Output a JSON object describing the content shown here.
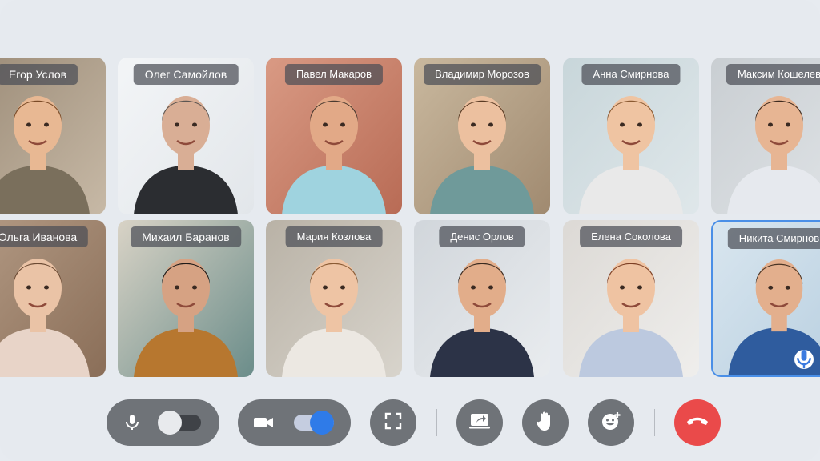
{
  "participants": [
    {
      "name": "Егор Услов",
      "skin": "#e8b893",
      "hair": "#7a4a26",
      "shirt": "#7a6f5c",
      "bg": "#c7b9a6",
      "bg2": "#9c8c78"
    },
    {
      "name": "Олег Самойлов",
      "skin": "#d9ae95",
      "hair": "#5c5652",
      "shirt": "#2b2d31",
      "bg": "#e2e6ea",
      "bg2": "#f3f5f7"
    },
    {
      "name": "Павел Макаров",
      "skin": "#e2a987",
      "hair": "#4a3a30",
      "shirt": "#9fd3df",
      "bg": "#b86b55",
      "bg2": "#d99a84"
    },
    {
      "name": "Владимир Морозов",
      "skin": "#ecc09f",
      "hair": "#5a3b24",
      "shirt": "#6f9a9a",
      "bg": "#a08a70",
      "bg2": "#c9b89e"
    },
    {
      "name": "Анна Смирнова",
      "skin": "#efc4a2",
      "hair": "#8a5a32",
      "shirt": "#e9e9e9",
      "bg": "#dfe7ea",
      "bg2": "#c8d6da"
    },
    {
      "name": "Максим Кошелев",
      "skin": "#e7b593",
      "hair": "#3d2a1e",
      "shirt": "#e6e9ee",
      "bg": "#dfe3e6",
      "bg2": "#c9ced2"
    },
    {
      "name": "Ольга Иванова",
      "skin": "#eac3a6",
      "hair": "#6b4a33",
      "shirt": "#e8d4c8",
      "bg": "#8a6e58",
      "bg2": "#b39a84"
    },
    {
      "name": "Михаил Баранов",
      "skin": "#d6a283",
      "hair": "#1e1a18",
      "shirt": "#b7772f",
      "bg": "#6b8d8a",
      "bg2": "#d9d3c6"
    },
    {
      "name": "Мария Козлова",
      "skin": "#eec4a4",
      "hair": "#8a5b34",
      "shirt": "#ece8e2",
      "bg": "#d8d4cc",
      "bg2": "#b9b2a6"
    },
    {
      "name": "Денис Орлов",
      "skin": "#e2ad8a",
      "hair": "#3a2a20",
      "shirt": "#2c3347",
      "bg": "#e9ecef",
      "bg2": "#d1d6db"
    },
    {
      "name": "Елена Соколова",
      "skin": "#efc3a2",
      "hair": "#7d3f24",
      "shirt": "#bcc9df",
      "bg": "#efeeec",
      "bg2": "#dcd9d5"
    },
    {
      "name": "Никита Смирнов",
      "skin": "#e3af8d",
      "hair": "#4a3424",
      "shirt": "#2f5c9e",
      "bg": "#b8cfe0",
      "bg2": "#d9e6ef"
    }
  ],
  "active_speaker": "Никита Смирнов",
  "controls": {
    "microphone": {
      "icon": "microphone-icon",
      "enabled": false
    },
    "camera": {
      "icon": "video-camera-icon",
      "enabled": true
    },
    "fullscreen": {
      "icon": "fullscreen-icon"
    },
    "share_screen": {
      "icon": "share-screen-icon"
    },
    "raise_hand": {
      "icon": "raise-hand-icon"
    },
    "reactions": {
      "icon": "add-emoji-icon"
    },
    "end_call": {
      "icon": "hang-up-icon",
      "color": "#ea4a4a"
    }
  },
  "colors": {
    "accent": "#2f7be8",
    "control_bg": "#6f7378",
    "page_bg": "#e6eaef"
  }
}
